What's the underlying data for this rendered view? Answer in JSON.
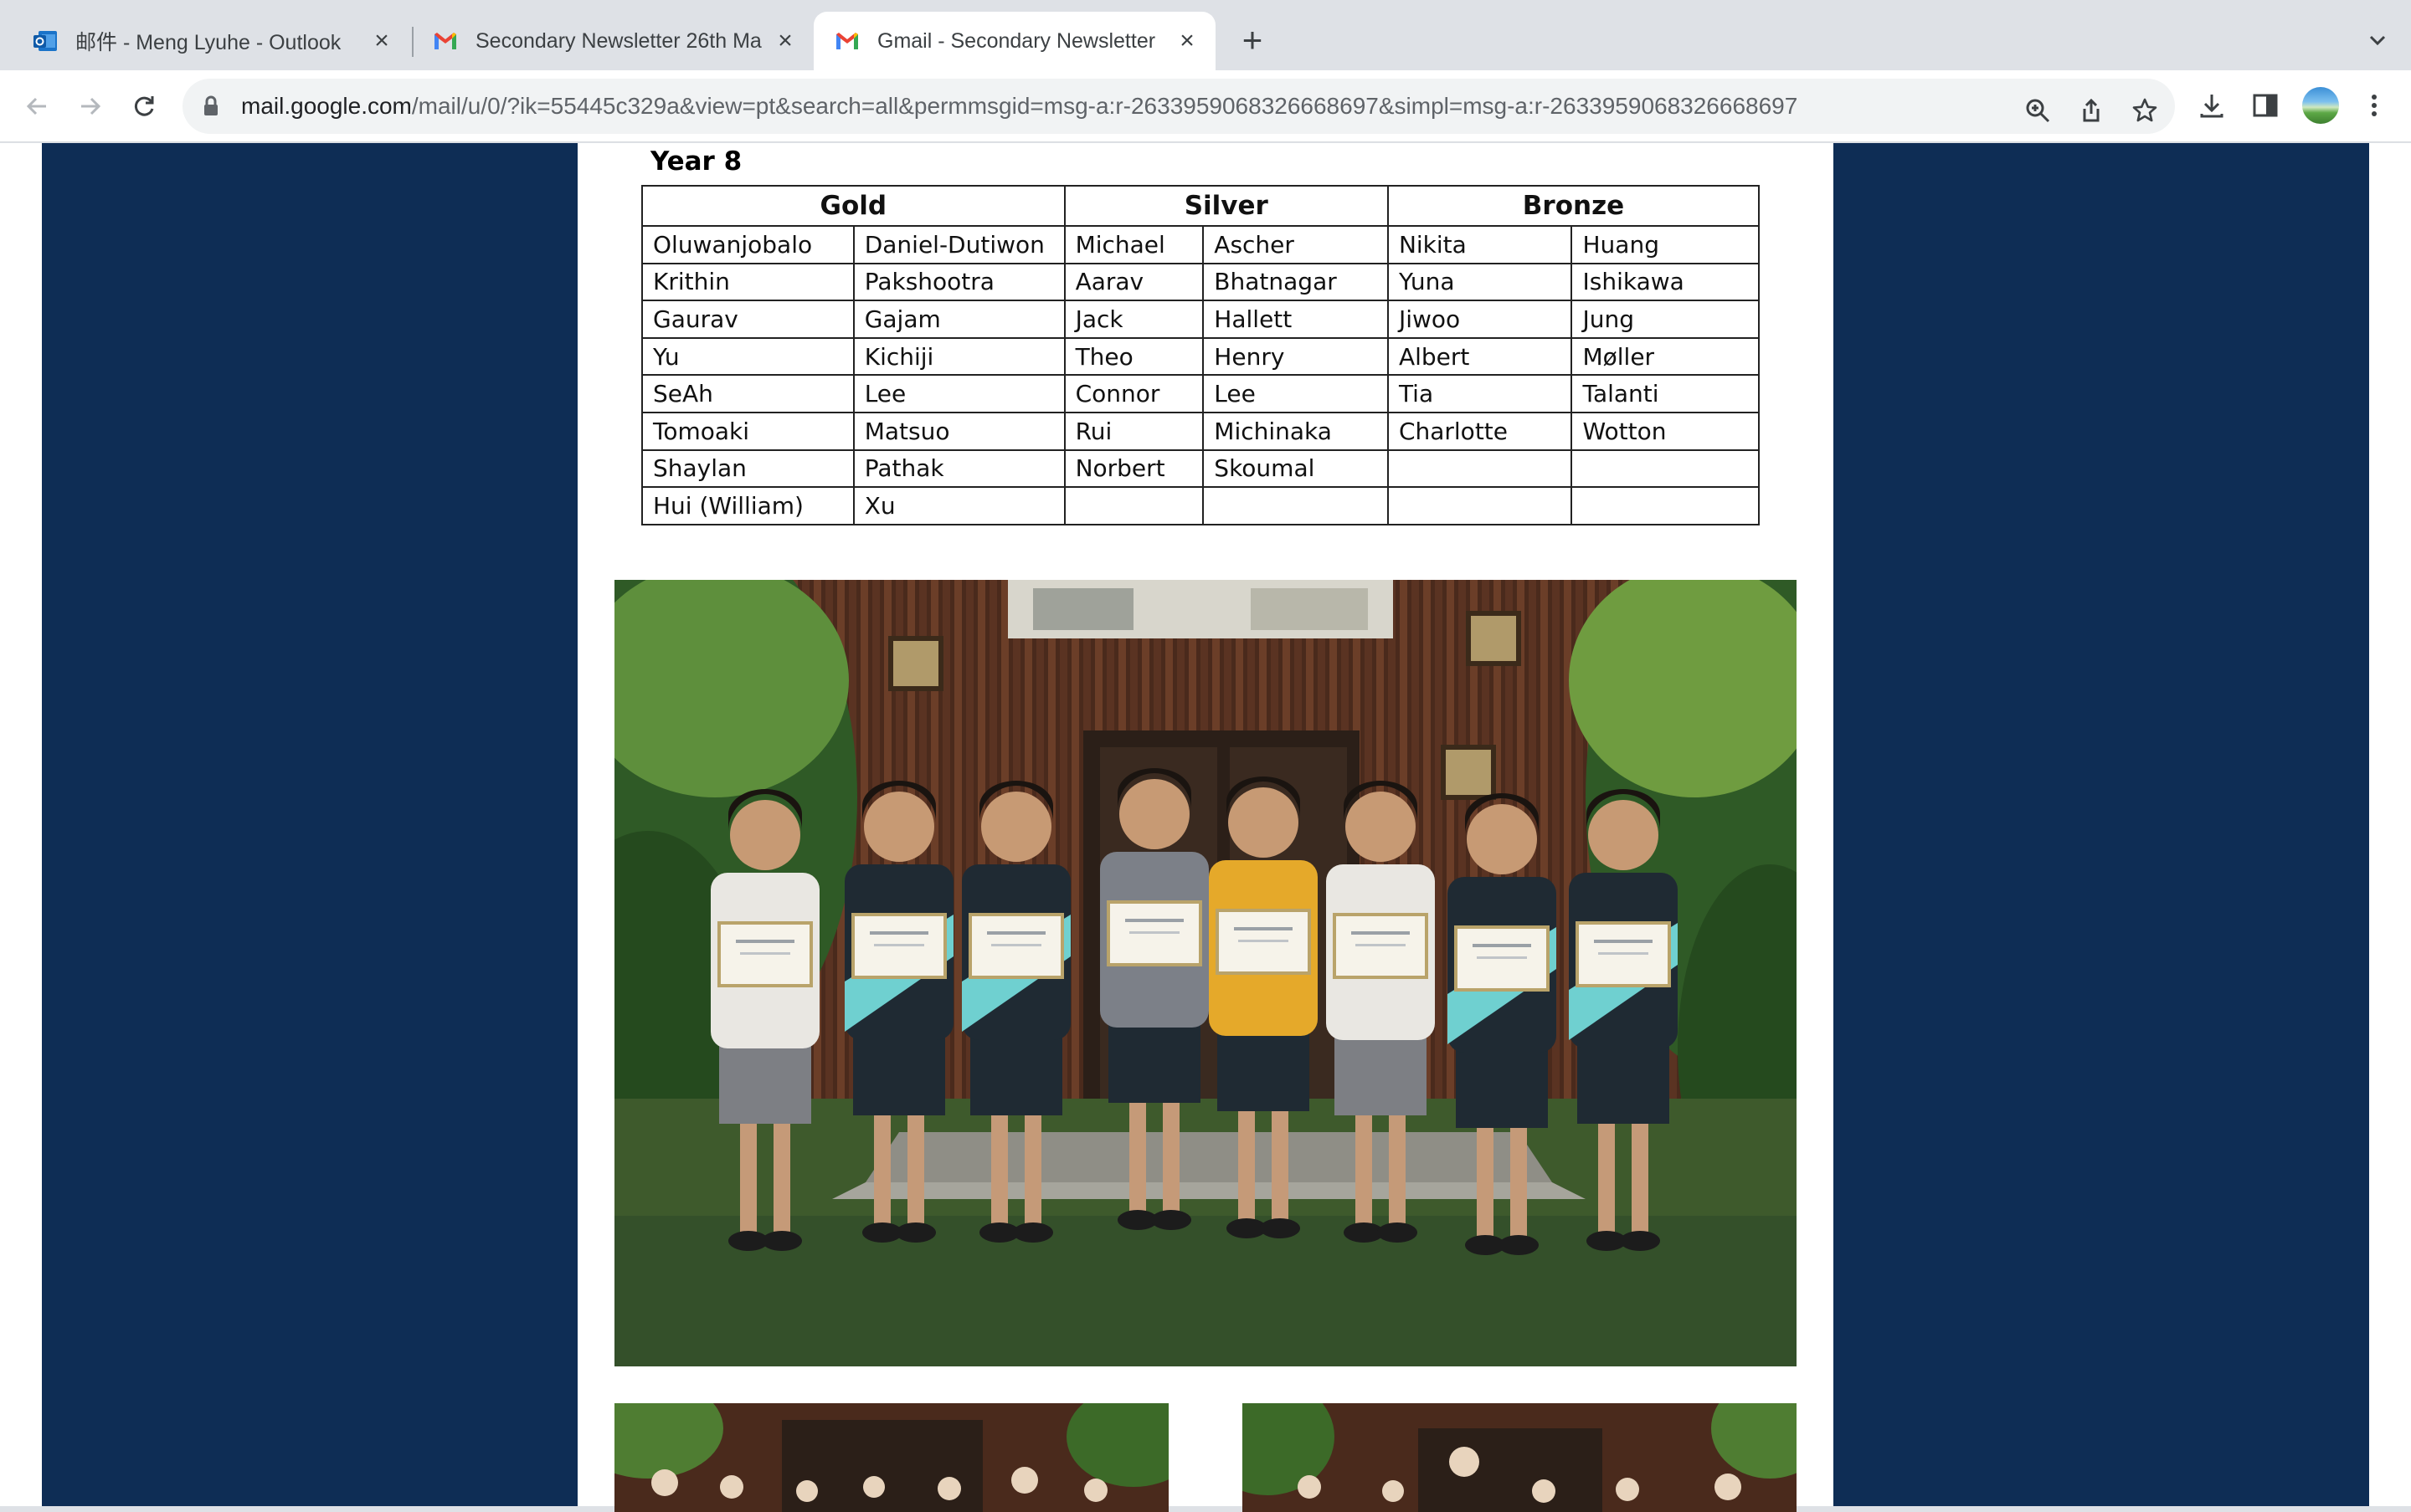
{
  "browser": {
    "tabs": [
      {
        "title": "邮件 - Meng Lyuhe - Outlook",
        "icon": "outlook-icon",
        "active": false
      },
      {
        "title": "Secondary Newsletter 26th Ma",
        "icon": "gmail-icon",
        "active": false
      },
      {
        "title": "Gmail - Secondary Newsletter",
        "icon": "gmail-icon",
        "active": true
      }
    ],
    "new_tab_label": "+",
    "address": {
      "host": "mail.google.com",
      "path": "/mail/u/0/?ik=55445c329a&view=pt&search=all&permmsgid=msg-a:r-2633959068326668697&simpl=msg-a:r-2633959068326668697"
    }
  },
  "newsletter": {
    "year_label": "Year 8",
    "awards_table": {
      "headers": [
        "Gold",
        "Silver",
        "Bronze"
      ],
      "rows": [
        [
          "Oluwanjobalo",
          "Daniel-Dutiwon",
          "Michael",
          "Ascher",
          "Nikita",
          "Huang"
        ],
        [
          "Krithin",
          "Pakshootra",
          "Aarav",
          "Bhatnagar",
          "Yuna",
          "Ishikawa"
        ],
        [
          "Gaurav",
          "Gajam",
          "Jack",
          "Hallett",
          "Jiwoo",
          "Jung"
        ],
        [
          "Yu",
          "Kichiji",
          "Theo",
          "Henry",
          "Albert",
          "Møller"
        ],
        [
          "SeAh",
          "Lee",
          "Connor",
          "Lee",
          "Tia",
          "Talanti"
        ],
        [
          "Tomoaki",
          "Matsuo",
          "Rui",
          "Michinaka",
          "Charlotte",
          "Wotton"
        ],
        [
          "Shaylan",
          "Pathak",
          "Norbert",
          "Skoumal",
          "",
          ""
        ],
        [
          "Hui (William)",
          "Xu",
          "",
          "",
          "",
          ""
        ]
      ]
    }
  },
  "colors": {
    "navy_background": "#0e2d55",
    "tabstrip": "#dee1e6",
    "omnibox": "#f1f3f4"
  }
}
